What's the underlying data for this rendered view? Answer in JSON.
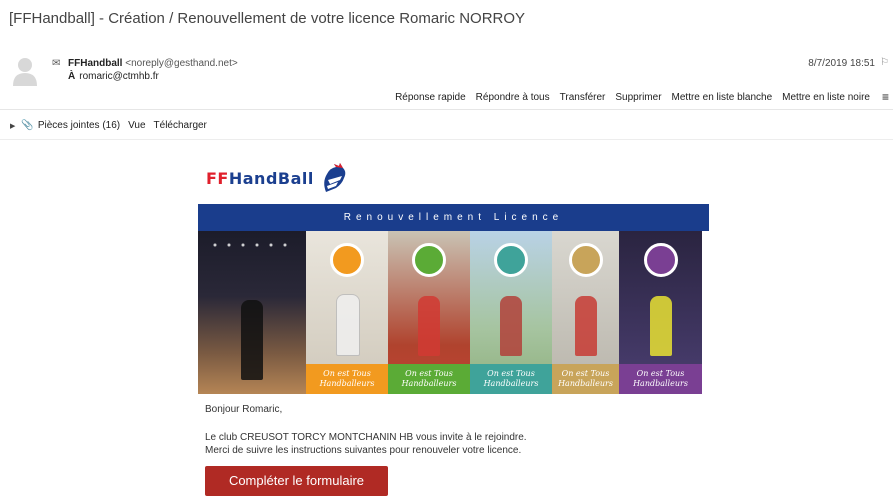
{
  "email": {
    "subject": "[FFHandball] - Création / Renouvellement de votre licence Romaric NORROY",
    "from_name": "FFHandball",
    "from_address": "<noreply@gesthand.net>",
    "to_label": "À",
    "to_address": "romaric@ctmhb.fr",
    "date": "8/7/2019 18:51"
  },
  "actions": [
    "Réponse rapide",
    "Répondre à tous",
    "Transférer",
    "Supprimer",
    "Mettre en liste blanche",
    "Mettre en liste noire"
  ],
  "attachments": {
    "label": "Pièces jointes (16)",
    "view": "Vue",
    "download": "Télécharger"
  },
  "content": {
    "logo_ff": "FF",
    "logo_hb": "HandBall",
    "banner": "Renouvellement Licence",
    "panel_slogan": "On est Tous Handballeurs",
    "greeting": "Bonjour Romaric,",
    "line1": "Le club CREUSOT TORCY MONTCHANIN HB vous invite à le rejoindre.",
    "line2": "Merci de suivre les instructions suivantes pour renouveler votre licence.",
    "cta": "Compléter le formulaire"
  },
  "colors": {
    "banner": "#1a3d8c",
    "cta": "#b02a24",
    "bar_orange": "#f29a1f",
    "bar_green": "#5bab36",
    "bar_teal": "#3fa39a",
    "bar_gold": "#c8a45a",
    "bar_purple": "#7a3f93"
  },
  "icons": [
    "avatar-icon",
    "envelope-icon",
    "flag-icon",
    "menu-icon",
    "expand-triangle-icon",
    "paperclip-icon",
    "rooster-icon"
  ]
}
